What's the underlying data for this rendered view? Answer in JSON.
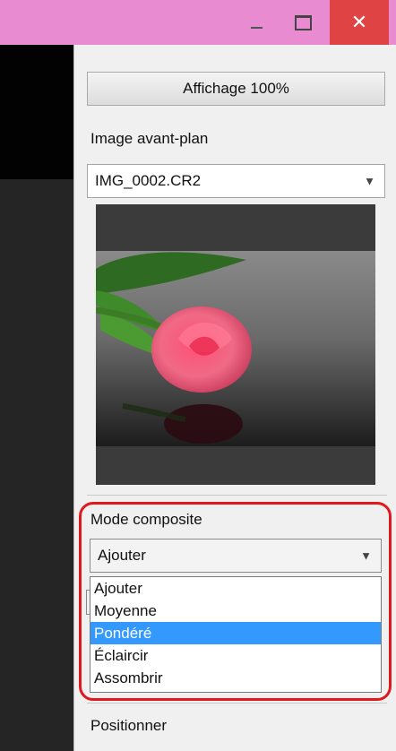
{
  "window": {
    "minimize_icon": "minimize-icon",
    "maximize_icon": "maximize-icon",
    "close_glyph": "✕"
  },
  "panel": {
    "zoom_button_label": "Affichage 100%",
    "foreground_label": "Image avant-plan",
    "foreground_value": "IMG_0002.CR2",
    "composite_label": "Mode composite",
    "composite_value": "Ajouter",
    "composite_options": [
      "Ajouter",
      "Moyenne",
      "Pondéré",
      "Éclaircir",
      "Assombrir"
    ],
    "composite_selected_index": 2,
    "position_label": "Positionner"
  },
  "colors": {
    "titlebar": "#e98bd0",
    "close_button": "#e04343",
    "highlight_border": "#e0191d",
    "selection": "#3399ff"
  }
}
